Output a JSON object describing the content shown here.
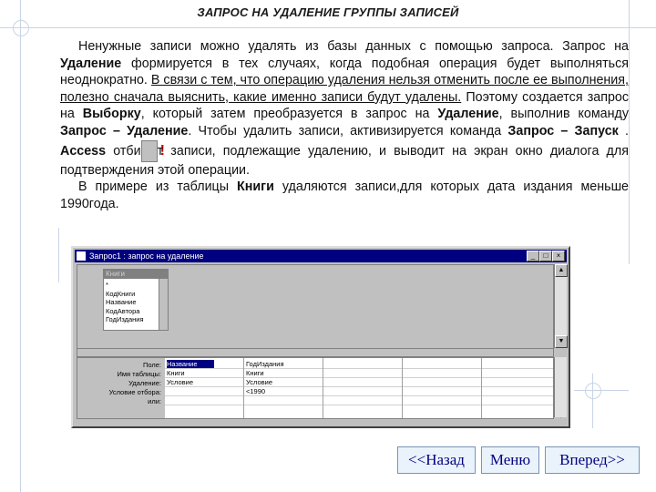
{
  "title": "ЗАПРОС НА УДАЛЕНИЕ ГРУППЫ ЗАПИСЕЙ",
  "text": {
    "p1_a": "Ненужные записи можно удалять из базы данных с помощью запроса. Запрос на ",
    "p1_b": "Удаление",
    "p1_c": " формируется в тех случаях, когда подобная операция будет выполняться неоднократно. ",
    "p1_d": "В связи с тем, что операцию удаления нельзя отменить после ее выполнения, полезно сначала выяснить, какие именно записи будут удалены.",
    "p1_e": " Поэтому создается запрос на ",
    "p1_f": "Выборку",
    "p1_g": ", который затем преобразуется в запрос на ",
    "p1_h": "Удаление",
    "p1_i": ", выполнив команду ",
    "p1_j": "Запрос – Удаление",
    "p1_k": ". Чтобы удалить записи, активизируется команда ",
    "p1_l": "Запрос – Запуск",
    "p1_m": "   . ",
    "p1_n": "Access",
    "p1_o": " отби",
    "p1_p": "т записи, подлежащие удалению, и выводит на экран окно диалога для подтверждения этой операции.",
    "p2_a": "В примере из таблицы ",
    "p2_b": "Книги",
    "p2_c": " удаляются записи,для которых дата издания меньше 1990года.",
    "excl": "!"
  },
  "window": {
    "title": "Запрос1 : запрос на удаление",
    "table_box": {
      "title": "Книги",
      "fields": [
        "*",
        "КодКниги",
        "Название",
        "КодАвтора",
        "ГодИздания"
      ]
    },
    "grid": {
      "row_labels": [
        "Поле:",
        "Имя таблицы:",
        "Удаление:",
        "Условие отбора:",
        "или:"
      ],
      "columns": [
        {
          "cells": [
            "Название",
            "Книги",
            "Условие",
            "",
            ""
          ]
        },
        {
          "cells": [
            "ГодИздания",
            "Книги",
            "Условие",
            "<1990",
            ""
          ]
        }
      ]
    }
  },
  "nav": {
    "back": "<<Назад",
    "menu": "Меню",
    "forward": "Вперед>>"
  },
  "colors": {
    "accent": "#000080",
    "window": "#c0c0c0",
    "deco": "#c8d4e6"
  }
}
